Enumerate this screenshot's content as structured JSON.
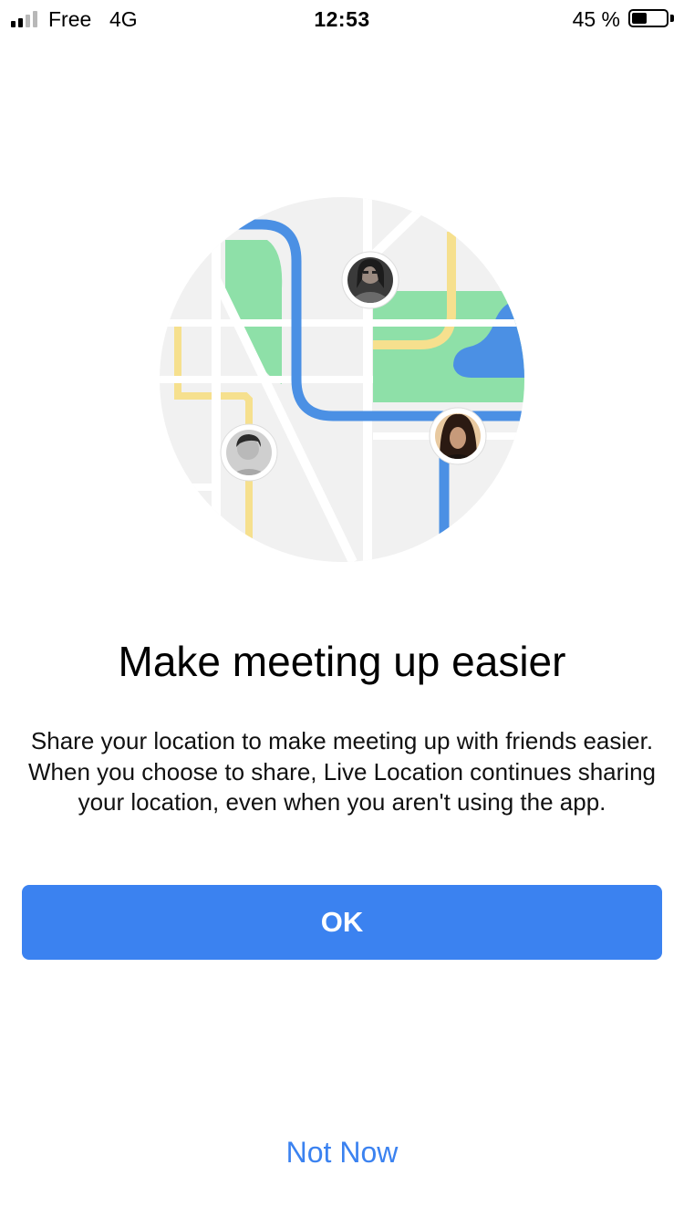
{
  "status_bar": {
    "carrier": "Free",
    "network": "4G",
    "time": "12:53",
    "battery_percent_label": "45 %",
    "battery_level": 0.45,
    "signal_bars_active": 2,
    "signal_bars_total": 4
  },
  "illustration": {
    "icon": "map-with-friends-illustration",
    "colors": {
      "background": "#f1f1f1",
      "park": "#8ee0a8",
      "water": "#4b90e4",
      "route": "#4b90e4",
      "road_yellow": "#f6e08e"
    },
    "avatars": [
      "friend-avatar-woman-glasses",
      "friend-avatar-man",
      "friend-avatar-woman"
    ]
  },
  "content": {
    "title": "Make meeting up easier",
    "description": "Share your location to make meeting up with friends easier. When you choose to share, Live Location continues sharing your location, even when you aren't using the app."
  },
  "actions": {
    "ok_label": "OK",
    "not_now_label": "Not Now",
    "accent_color": "#3b82f0"
  }
}
